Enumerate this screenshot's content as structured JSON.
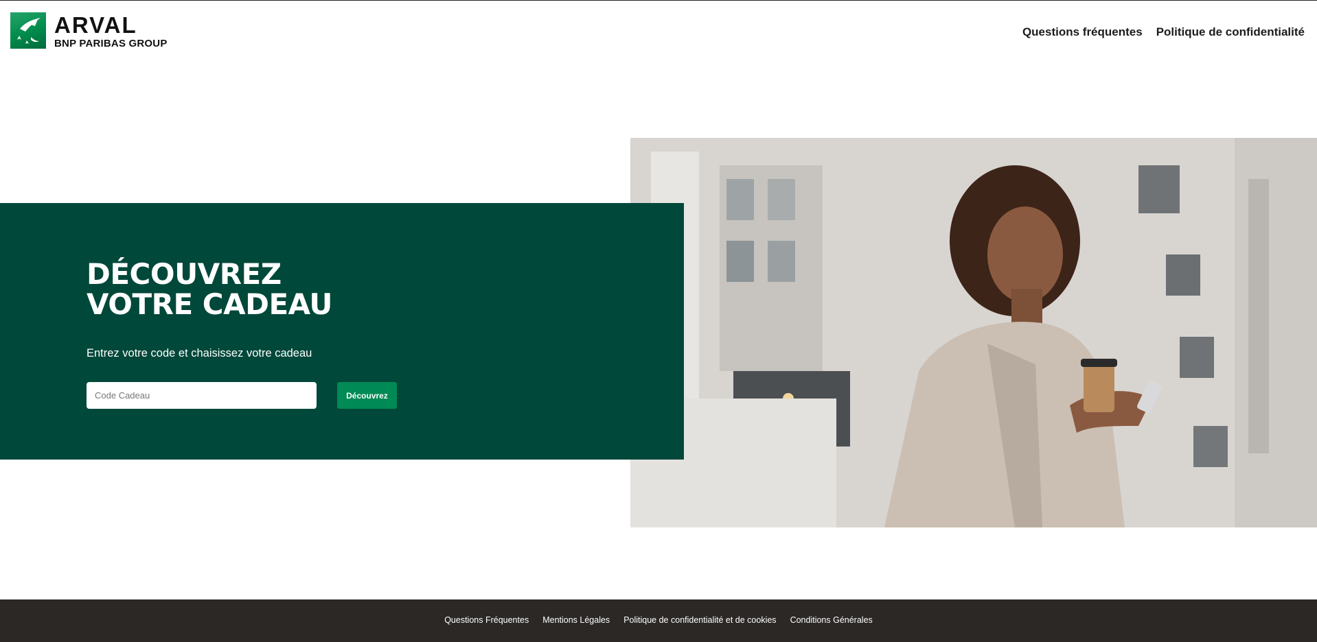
{
  "header": {
    "logo": {
      "brand": "ARVAL",
      "group": "BNP PARIBAS GROUP"
    },
    "nav": [
      {
        "label": "Questions fréquentes"
      },
      {
        "label": "Politique de confidentialité"
      }
    ]
  },
  "hero": {
    "title_line1": "DÉCOUVREZ",
    "title_line2": "VOTRE CADEAU",
    "subtitle": "Entrez votre code et chaisissez votre cadeau",
    "input": {
      "placeholder": "Code Cadeau",
      "value": ""
    },
    "button_label": "Découvrez",
    "image_icon": "woman-with-phone-and-coffee-photo"
  },
  "footer": {
    "links": [
      {
        "label": "Questions Fréquentes"
      },
      {
        "label": "Mentions Légales"
      },
      {
        "label": "Politique de confidentialité et de cookies"
      },
      {
        "label": "Conditions Générales"
      }
    ]
  },
  "colors": {
    "brand_green": "#00483a",
    "button_green": "#008a55",
    "logo_green": "#00965e",
    "footer_bg": "#2b2826"
  }
}
